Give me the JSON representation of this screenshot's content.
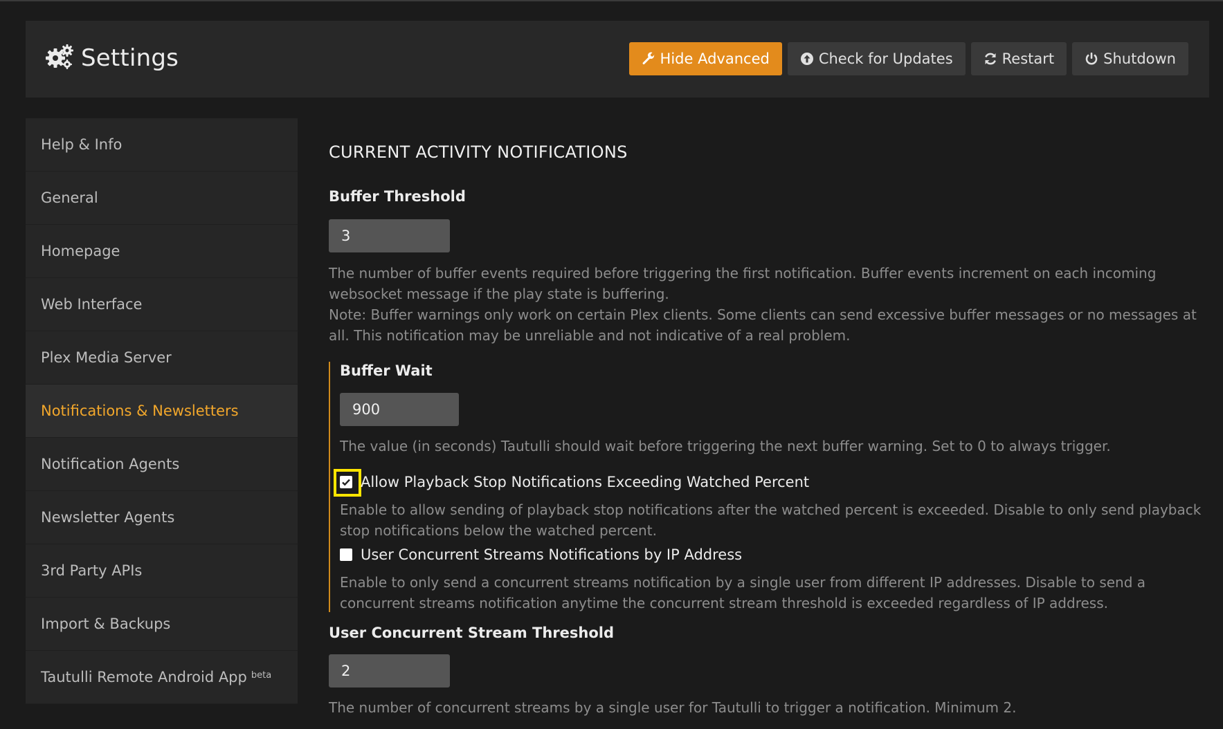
{
  "header": {
    "title": "Settings",
    "buttons": {
      "hide_advanced": "Hide Advanced",
      "check_updates": "Check for Updates",
      "restart": "Restart",
      "shutdown": "Shutdown"
    }
  },
  "sidebar": {
    "items": [
      {
        "label": "Help & Info"
      },
      {
        "label": "General"
      },
      {
        "label": "Homepage"
      },
      {
        "label": "Web Interface"
      },
      {
        "label": "Plex Media Server"
      },
      {
        "label": "Notifications & Newsletters"
      },
      {
        "label": "Notification Agents"
      },
      {
        "label": "Newsletter Agents"
      },
      {
        "label": "3rd Party APIs"
      },
      {
        "label": "Import & Backups"
      },
      {
        "label": "Tautulli Remote Android App",
        "badge": "beta"
      }
    ],
    "active_index": 5
  },
  "main": {
    "section_title": "CURRENT ACTIVITY NOTIFICATIONS",
    "buffer_threshold": {
      "label": "Buffer Threshold",
      "value": "3",
      "help1": "The number of buffer events required before triggering the first notification. Buffer events increment on each incoming websocket message if the play state is buffering.",
      "help2": "Note: Buffer warnings only work on certain Plex clients. Some clients can send excessive buffer messages or no messages at all. This notification may be unreliable and not indicative of a real problem."
    },
    "buffer_wait": {
      "label": "Buffer Wait",
      "value": "900",
      "help": "The value (in seconds) Tautulli should wait before triggering the next buffer warning. Set to 0 to always trigger."
    },
    "allow_playback_stop": {
      "label": "Allow Playback Stop Notifications Exceeding Watched Percent",
      "checked": true,
      "help": "Enable to allow sending of playback stop notifications after the watched percent is exceeded. Disable to only send playback stop notifications below the watched percent."
    },
    "concurrent_by_ip": {
      "label": "User Concurrent Streams Notifications by IP Address",
      "checked": false,
      "help": "Enable to only send a concurrent streams notification by a single user from different IP addresses. Disable to send a concurrent streams notification anytime the concurrent stream threshold is exceeded regardless of IP address."
    },
    "concurrent_threshold": {
      "label": "User Concurrent Stream Threshold",
      "value": "2",
      "help": "The number of concurrent streams by a single user for Tautulli to trigger a notification. Minimum 2."
    }
  },
  "colors": {
    "accent": "#e38b1c",
    "active_nav": "#f2a72b",
    "focus_outline": "#ffe500"
  }
}
